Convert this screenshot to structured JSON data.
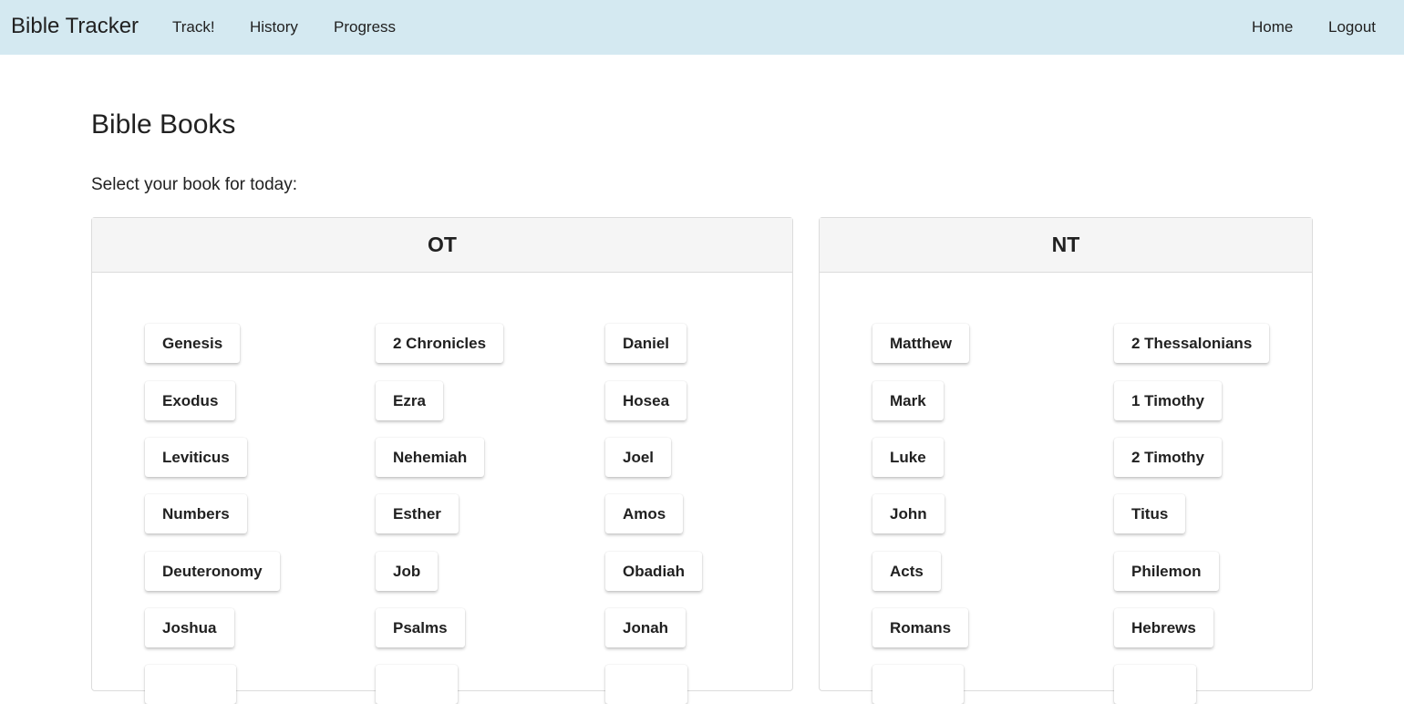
{
  "navbar": {
    "brand": "Bible Tracker",
    "left_links": [
      "Track!",
      "History",
      "Progress"
    ],
    "right_links": [
      "Home",
      "Logout"
    ]
  },
  "main": {
    "title": "Bible Books",
    "subtitle": "Select your book for today:"
  },
  "ot": {
    "header": "OT",
    "columns": [
      [
        "Genesis",
        "Exodus",
        "Leviticus",
        "Numbers",
        "Deuteronomy",
        "Joshua",
        ""
      ],
      [
        "2 Chronicles",
        "Ezra",
        "Nehemiah",
        "Esther",
        "Job",
        "Psalms",
        ""
      ],
      [
        "Daniel",
        "Hosea",
        "Joel",
        "Amos",
        "Obadiah",
        "Jonah",
        ""
      ]
    ]
  },
  "nt": {
    "header": "NT",
    "columns": [
      [
        "Matthew",
        "Mark",
        "Luke",
        "John",
        "Acts",
        "Romans",
        ""
      ],
      [
        "2 Thessalonians",
        "1 Timothy",
        "2 Timothy",
        "Titus",
        "Philemon",
        "Hebrews",
        ""
      ]
    ]
  }
}
